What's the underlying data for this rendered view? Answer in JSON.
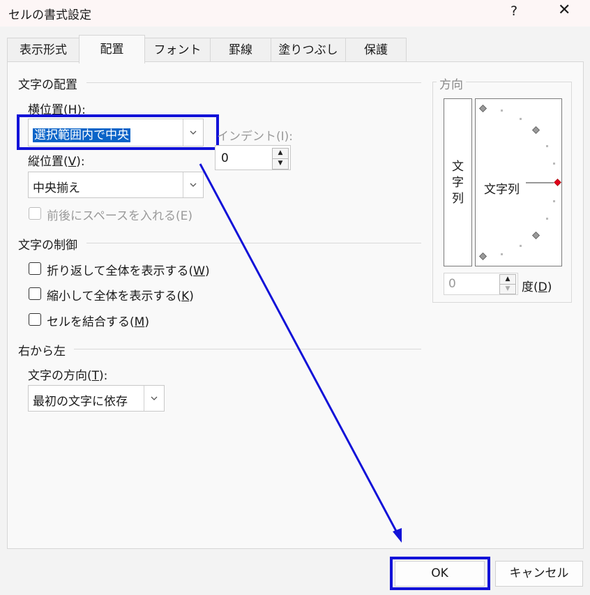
{
  "window": {
    "title": "セルの書式設定",
    "help": "?",
    "close": "✕"
  },
  "tabs": [
    {
      "label": "表示形式"
    },
    {
      "label": "配置",
      "active": true
    },
    {
      "label": "フォント"
    },
    {
      "label": "罫線"
    },
    {
      "label": "塗りつぶし"
    },
    {
      "label": "保護"
    }
  ],
  "text_alignment": {
    "heading": "文字の配置",
    "horizontal": {
      "label": "横位置(",
      "key": "H",
      "label_end": "):",
      "value": "選択範囲内で中央"
    },
    "indent": {
      "label": "インデント(I):",
      "value": "0"
    },
    "vertical": {
      "label": "縦位置(",
      "key": "V",
      "label_end": "):",
      "value": "中央揃え"
    },
    "justify_distributed": {
      "label": "前後にスペースを入れる(E)",
      "checked": false,
      "disabled": true
    }
  },
  "text_control": {
    "heading": "文字の制御",
    "wrap": {
      "label": "折り返して全体を表示する(",
      "key": "W",
      "end": ")",
      "checked": false
    },
    "shrink": {
      "label": "縮小して全体を表示する(",
      "key": "K",
      "end": ")",
      "checked": false
    },
    "merge": {
      "label": "セルを結合する(",
      "key": "M",
      "end": ")",
      "checked": false
    }
  },
  "rtl": {
    "heading": "右から左",
    "direction": {
      "label": "文字の方向(",
      "key": "T",
      "label_end": "):",
      "value": "最初の文字に依存"
    }
  },
  "orientation": {
    "heading": "方向",
    "vertical_text": [
      "文",
      "字",
      "列"
    ],
    "dial_text": "文字列",
    "degrees_value": "0",
    "degrees_label": "度(",
    "degrees_key": "D",
    "degrees_end": ")"
  },
  "buttons": {
    "ok": "OK",
    "cancel": "キャンセル"
  },
  "colors": {
    "annotation": "#1212d8",
    "selection": "#0a64c8",
    "marker": "#e0001a"
  }
}
